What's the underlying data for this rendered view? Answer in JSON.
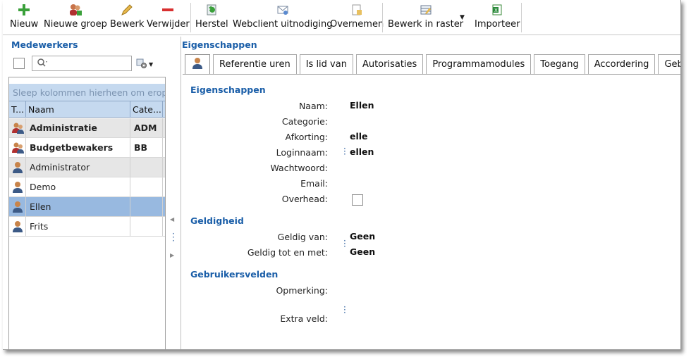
{
  "toolbar": {
    "buttons": [
      {
        "label": "Nieuw",
        "icon": "plus-icon"
      },
      {
        "label": "Nieuwe groep",
        "icon": "new-group-icon"
      },
      {
        "label": "Bewerk",
        "icon": "pencil-icon"
      },
      {
        "label": "Verwijder",
        "icon": "minus-icon"
      },
      {
        "label": "Herstel",
        "icon": "restore-icon"
      },
      {
        "label": "Webclient uitnodiging",
        "icon": "web-invite-icon"
      },
      {
        "label": "Overnemen",
        "icon": "copy-icon"
      },
      {
        "label": "Bewerk in raster",
        "icon": "grid-edit-icon"
      },
      {
        "label": "Importeer",
        "icon": "excel-import-icon"
      }
    ]
  },
  "left": {
    "title": "Medewerkers",
    "search_placeholder": "",
    "group_hint": "Sleep kolommen hierheen om erop te groeperen",
    "columns": [
      "T...",
      "Naam",
      "Cate..."
    ],
    "rows": [
      {
        "name": "Administratie",
        "category": "ADM",
        "type": "group",
        "bold": true
      },
      {
        "name": "Budgetbewakers",
        "category": "BB",
        "type": "group",
        "bold": true
      },
      {
        "name": "Administrator",
        "category": "",
        "type": "user",
        "bold": false
      },
      {
        "name": "Demo",
        "category": "",
        "type": "user",
        "bold": false
      },
      {
        "name": "Ellen",
        "category": "",
        "type": "user",
        "bold": false,
        "selected": true
      },
      {
        "name": "Frits",
        "category": "",
        "type": "user",
        "bold": false
      }
    ]
  },
  "right": {
    "title": "Eigenschappen",
    "tabs": [
      "Referentie uren",
      "Is lid van",
      "Autorisaties",
      "Programmamodules",
      "Toegang",
      "Accordering",
      "Gebruik"
    ],
    "sections": {
      "eigenschappen": "Eigenschappen",
      "geldigheid": "Geldigheid",
      "gebruikersvelden": "Gebruikersvelden"
    },
    "fields": {
      "naam": {
        "label": "Naam:",
        "value": "Ellen"
      },
      "categorie": {
        "label": "Categorie:",
        "value": ""
      },
      "afkorting": {
        "label": "Afkorting:",
        "value": "elle"
      },
      "loginnaam": {
        "label": "Loginnaam:",
        "value": "ellen"
      },
      "wachtwoord": {
        "label": "Wachtwoord:",
        "value": ""
      },
      "email": {
        "label": "Email:",
        "value": ""
      },
      "overhead": {
        "label": "Overhead:",
        "checked": false
      },
      "geldig_van": {
        "label": "Geldig van:",
        "value": "Geen"
      },
      "geldig_tot": {
        "label": "Geldig tot en met:",
        "value": "Geen"
      },
      "opmerking": {
        "label": "Opmerking:",
        "value": ""
      },
      "extra_veld": {
        "label": "Extra veld:",
        "value": ""
      }
    }
  },
  "colors": {
    "accent": "#1a5ea8",
    "selection": "#98b9e0",
    "header": "#c5d9ef"
  }
}
